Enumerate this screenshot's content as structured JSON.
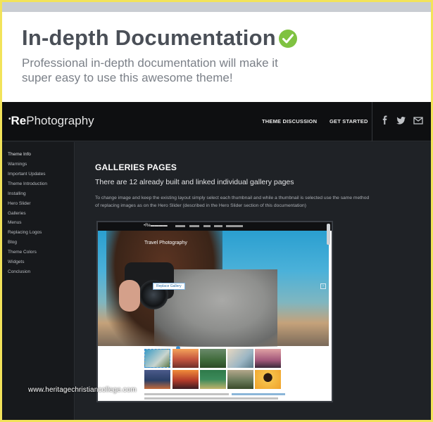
{
  "hero": {
    "title": "In-depth Documentation",
    "subtitle": "Professional in-depth documentation will make it super easy to use this awesome theme!"
  },
  "nav": {
    "logo_prefix": "Re",
    "logo_suffix": "Photography",
    "links": [
      "THEME DISCUSSION",
      "GET STARTED"
    ],
    "social_icons": [
      "facebook-icon",
      "twitter-icon",
      "mail-icon"
    ]
  },
  "sidebar": {
    "items": [
      "Theme Info",
      "Warnings",
      "Important Updates",
      "Theme Introduction",
      "Installing",
      "Hero Slider",
      "Galleries",
      "Menus",
      "Replacing Logos",
      "Blog",
      "Theme Colors",
      "Widgets",
      "Conclusion"
    ]
  },
  "content": {
    "heading": "GALLERIES PAGES",
    "subheading": "There are 12 already built and linked individual gallery pages",
    "paragraph": "To change image and keep the existing layout simply select each thumbnail and while a thumbnail is selected use the same method of replacing images as on the Hero Slider (described in the Hero Slider section of this documentation)"
  },
  "screenshot": {
    "caption": "Travel Photography",
    "badge": "Replace Gallery"
  },
  "watermark": "www.heritagechristiancollege.com",
  "colors": {
    "accent_check": "#7fc241",
    "frame": "#f2e35a",
    "dark_bg": "#1d2024"
  }
}
